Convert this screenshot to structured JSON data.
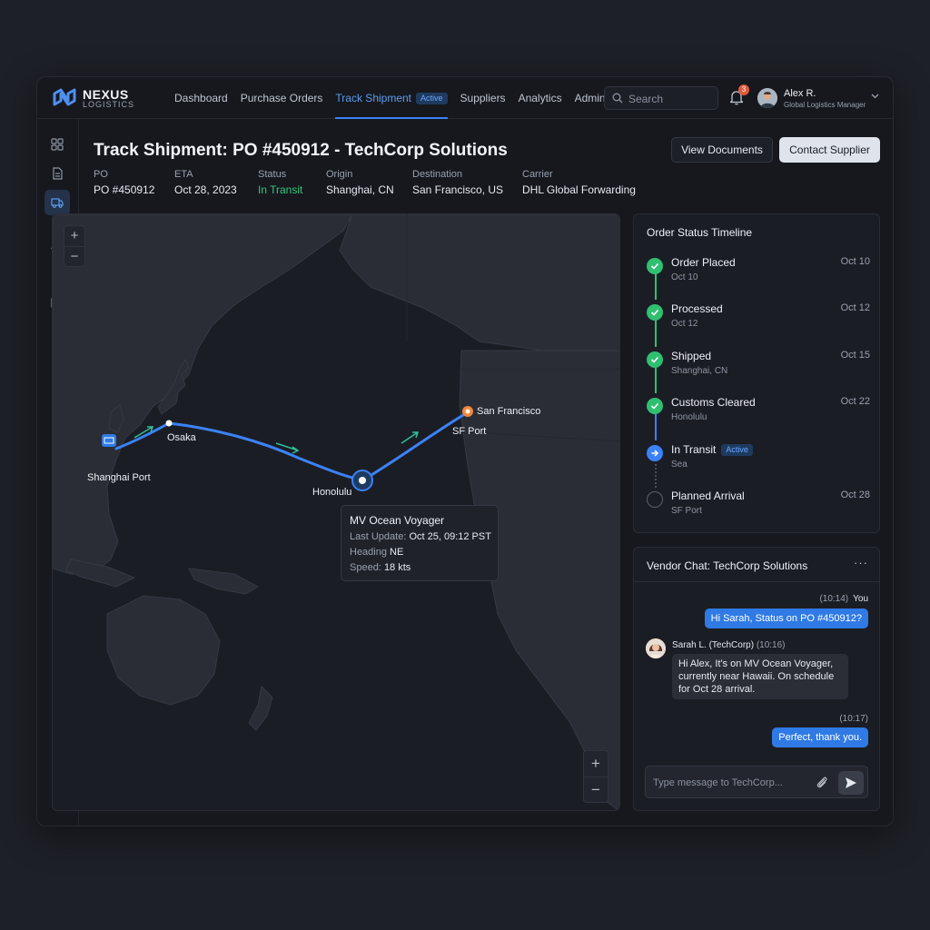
{
  "brand": {
    "name": "NEXUS",
    "tagline": "LOGISTICS"
  },
  "nav": [
    {
      "label": "Dashboard"
    },
    {
      "label": "Purchase Orders"
    },
    {
      "label": "Track Shipment",
      "badge": "Active",
      "active": true
    },
    {
      "label": "Suppliers"
    },
    {
      "label": "Analytics"
    },
    {
      "label": "Admin"
    }
  ],
  "search": {
    "placeholder": "Search"
  },
  "notifications": {
    "count": "3"
  },
  "user": {
    "name": "Alex R.",
    "role": "Global Logistics Manager"
  },
  "rail_icons": [
    "grid-icon",
    "document-icon",
    "truck-icon",
    "users-icon",
    "bar-chart-icon",
    "folder-icon",
    "gear-icon"
  ],
  "page": {
    "title": "Track Shipment: PO #450912 - TechCorp Solutions",
    "view_documents": "View Documents",
    "contact_supplier": "Contact Supplier"
  },
  "meta": [
    {
      "key": "PO",
      "value": "PO #450912"
    },
    {
      "key": "ETA",
      "value": "Oct 28, 2023"
    },
    {
      "key": "Status",
      "value": "In Transit"
    },
    {
      "key": "Origin",
      "value": "Shanghai, CN"
    },
    {
      "key": "Destination",
      "value": "San Francisco, US"
    },
    {
      "key": "Carrier",
      "value": "DHL Global Forwarding"
    }
  ],
  "map": {
    "zoom_in": "+",
    "zoom_out": "−",
    "labels": {
      "shanghai": "Shanghai Port",
      "osaka": "Osaka",
      "honolulu": "Honolulu",
      "san_francisco": "San Francisco",
      "sf_port": "SF Port"
    },
    "vessel": {
      "name": "MV Ocean Voyager",
      "last_update_label": "Last Update:",
      "last_update": "Oct 25, 09:12 PST",
      "heading_label": "Heading",
      "heading": "NE",
      "speed_label": "Speed:",
      "speed": "18 kts"
    },
    "colors": {
      "route": "#3b82f6",
      "origin": "#2f7ae5",
      "destination": "#f0883e"
    }
  },
  "timeline": {
    "title": "Order Status Timeline",
    "steps": [
      {
        "name": "Order Placed",
        "sub": "Oct 10",
        "date": "Oct 10",
        "state": "done"
      },
      {
        "name": "Processed",
        "sub": "Oct 12",
        "date": "Oct 12",
        "state": "done"
      },
      {
        "name": "Shipped",
        "sub": "Shanghai, CN",
        "date": "Oct 15",
        "state": "done"
      },
      {
        "name": "Customs Cleared",
        "sub": "Honolulu",
        "date": "Oct 22",
        "state": "done"
      },
      {
        "name": "In Transit",
        "sub": "Sea",
        "date": "",
        "badge": "Active",
        "state": "active"
      },
      {
        "name": "Planned Arrival",
        "sub": "SF Port",
        "date": "Oct 28",
        "state": "pending"
      }
    ]
  },
  "chat": {
    "title": "Vendor Chat: TechCorp Solutions",
    "more": "···",
    "messages": [
      {
        "time": "(10:14)",
        "author": "You",
        "text": "Hi Sarah, Status on PO #450912?"
      },
      {
        "author": "Sarah L. (TechCorp)",
        "time": "(10:16)",
        "text": "Hi Alex, It's on MV Ocean Voyager, currently near Hawaii. On schedule for Oct 28 arrival."
      },
      {
        "time": "(10:17)",
        "author": "",
        "text": "Perfect, thank you."
      }
    ],
    "composer_placeholder": "Type message to TechCorp..."
  }
}
